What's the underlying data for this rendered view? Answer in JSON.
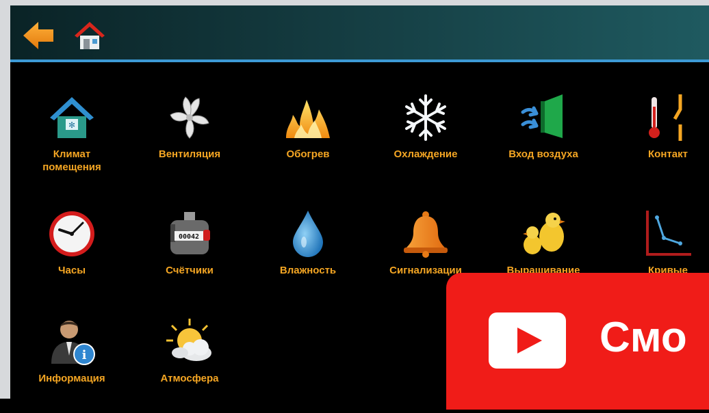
{
  "tiles": [
    {
      "label": "Климат\nпомещения",
      "icon": "house-climate-icon"
    },
    {
      "label": "Вентиляция",
      "icon": "fan-icon"
    },
    {
      "label": "Обогрев",
      "icon": "fire-icon"
    },
    {
      "label": "Охлаждение",
      "icon": "snowflake-icon"
    },
    {
      "label": "Вход воздуха",
      "icon": "air-inlet-icon"
    },
    {
      "label": "Контакт",
      "icon": "thermometer-contact-icon"
    },
    {
      "label": "Часы",
      "icon": "clock-icon"
    },
    {
      "label": "Счётчики",
      "icon": "counter-icon"
    },
    {
      "label": "Влажность",
      "icon": "water-drop-icon"
    },
    {
      "label": "Сигнализации",
      "icon": "alarm-bell-icon"
    },
    {
      "label": "Выращивание",
      "icon": "chicks-icon"
    },
    {
      "label": "Кривые",
      "icon": "curve-graph-icon"
    },
    {
      "label": "Информация",
      "icon": "user-info-icon"
    },
    {
      "label": "Атмосфера",
      "icon": "sun-cloud-icon"
    }
  ],
  "counter_display": "00042",
  "overlay": {
    "text": "Смо"
  },
  "colors": {
    "label": "#f5a623",
    "header_line": "#3d9ad6",
    "overlay_red": "#f01c18"
  }
}
